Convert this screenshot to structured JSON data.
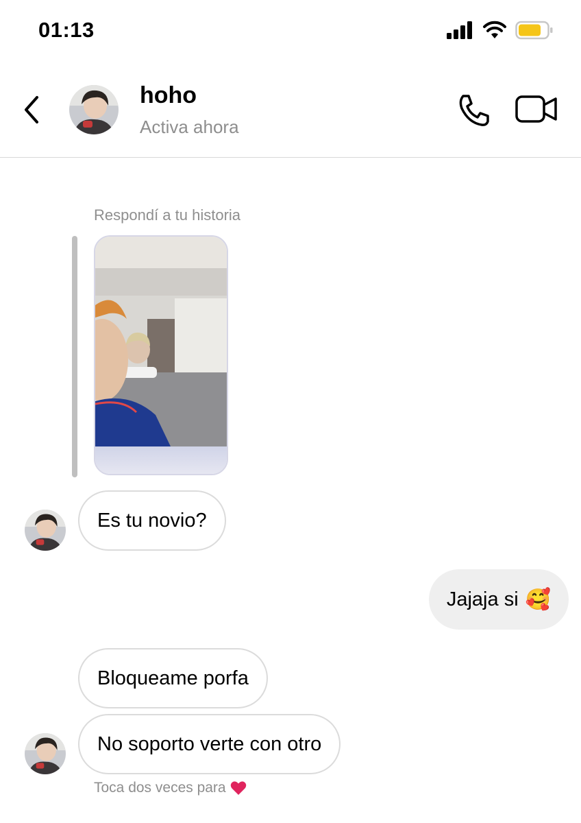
{
  "status_bar": {
    "time": "01:13",
    "battery_color": "#f5c518"
  },
  "header": {
    "name": "hoho",
    "status": "Activa ahora",
    "back_icon": "chevron-left-icon",
    "call_icon": "phone-icon",
    "video_icon": "video-camera-icon"
  },
  "conversation": {
    "story_reply_caption": "Respondí a tu historia",
    "messages": [
      {
        "from": "them",
        "text": "Es tu novio?"
      },
      {
        "from": "me",
        "text": "Jajaja si",
        "emoji": "🥰"
      },
      {
        "from": "them",
        "text": "Bloqueame porfa"
      },
      {
        "from": "them",
        "text": "No soporto verte con otro"
      }
    ],
    "double_tap_hint": "Toca dos veces para",
    "hint_icon": "heart-icon"
  },
  "colors": {
    "incoming_border": "#dbdbdb",
    "outgoing_bg": "#efefef",
    "secondary_text": "#8e8e8e",
    "heart": "#e0245e"
  }
}
